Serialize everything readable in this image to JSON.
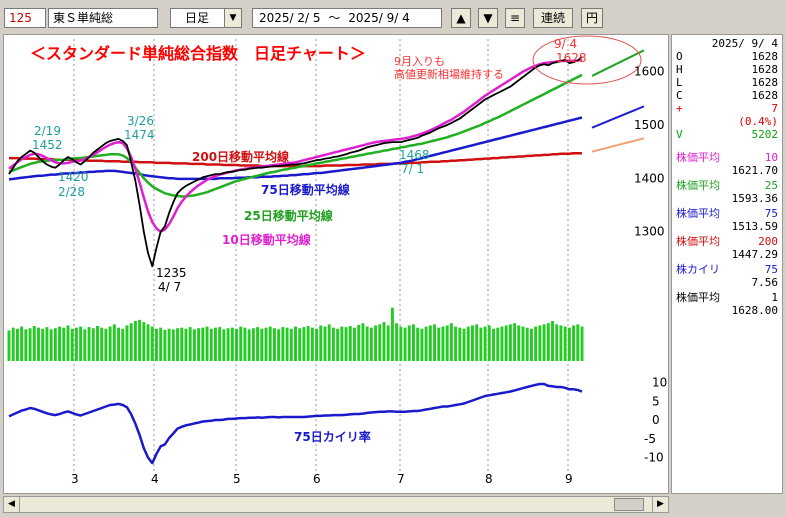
{
  "toolbar": {
    "code": "125",
    "name": "東Ｓ単純総",
    "period": "日足",
    "date_from": "2025/ 2/ 5",
    "tilde": "～",
    "date_to": "2025/ 9/ 4",
    "up_label": "▲",
    "down_label": "▼",
    "menu_label": "≡",
    "link_label": "連続",
    "yen_label": "円"
  },
  "chart": {
    "title": "＜スタンダード単純総合指数　日足チャート＞",
    "note_line1": "9月入りも",
    "note_line2": "高値更新相場維持する",
    "last_date": "9/ 4",
    "last_value": "1628",
    "ann_219_date": "2/19",
    "ann_219_value": "1452",
    "ann_326_date": "3/26",
    "ann_326_value": "1474",
    "ann_228_value": "1420",
    "ann_228_date": "2/28",
    "ann_low_value": "1235",
    "ann_low_date": "4/ 7",
    "ann_71_value": "1468",
    "ann_71_date": "7/ 1",
    "label_ma200": "200日移動平均線",
    "label_ma75": "75日移動平均線",
    "label_ma25": "25日移動平均線",
    "label_ma10": "10日移動平均線",
    "label_kairi": "75日カイリ率"
  },
  "colors": {
    "price": "#000000",
    "ma10": "#e020d0",
    "ma25": "#20b020",
    "ma75": "#1a1acc",
    "ma200": "#d01010",
    "volume": "#22cc22",
    "kairi": "#1a1acc",
    "title": "#ff0000",
    "cyan": "#20a0a0",
    "fc_green": "#20a020",
    "fc_blue": "#2020d0",
    "fc_orange": "#f0a070"
  },
  "side": {
    "date": "2025/ 9/ 4",
    "o_label": "O",
    "o_value": "1628",
    "h_label": "H",
    "h_value": "1628",
    "l_label": "L",
    "l_value": "1628",
    "c_label": "C",
    "c_value": "1628",
    "chg_label": "+",
    "chg_value": "7",
    "chg_pct": "(0.4%)",
    "v_label": "V",
    "v_value": "5202",
    "ma10_label": "株価平均",
    "ma10_period": "10",
    "ma10_value": "1621.70",
    "ma25_label": "株価平均",
    "ma25_period": "25",
    "ma25_value": "1593.36",
    "ma75_label": "株価平均",
    "ma75_period": "75",
    "ma75_value": "1513.59",
    "ma200_label": "株価平均",
    "ma200_period": "200",
    "ma200_value": "1447.29",
    "kairi_label": "株カイリ",
    "kairi_period": "75",
    "kairi_value": "7.56",
    "avg1_label": "株価平均",
    "avg1_period": "1",
    "avg1_value": "1628.00"
  },
  "chart_data": {
    "type": "line",
    "x_axis_months": [
      "3",
      "4",
      "5",
      "6",
      "7",
      "8",
      "9"
    ],
    "price_y_ticks": [
      1300,
      1400,
      1500,
      1600
    ],
    "price_ylim": [
      1200,
      1650
    ],
    "kairi_y_ticks": [
      10,
      5,
      0,
      -5,
      -10
    ],
    "kairi_ylim": [
      -12,
      12
    ],
    "price_close": [
      1408,
      1420,
      1432,
      1440,
      1446,
      1452,
      1448,
      1440,
      1432,
      1426,
      1422,
      1420,
      1426,
      1434,
      1440,
      1436,
      1430,
      1426,
      1432,
      1440,
      1448,
      1454,
      1460,
      1466,
      1470,
      1472,
      1474,
      1470,
      1462,
      1430,
      1395,
      1350,
      1300,
      1260,
      1235,
      1270,
      1300,
      1310,
      1335,
      1355,
      1372,
      1380,
      1386,
      1390,
      1394,
      1398,
      1402,
      1404,
      1406,
      1408,
      1408,
      1410,
      1412,
      1412,
      1414,
      1416,
      1416,
      1418,
      1419,
      1420,
      1420,
      1421,
      1422,
      1423,
      1423,
      1424,
      1425,
      1426,
      1426,
      1427,
      1428,
      1430,
      1432,
      1434,
      1435,
      1437,
      1438,
      1440,
      1441,
      1443,
      1445,
      1448,
      1450,
      1452,
      1455,
      1458,
      1460,
      1462,
      1464,
      1466,
      1467,
      1468,
      1468,
      1468,
      1470,
      1472,
      1474,
      1476,
      1480,
      1483,
      1486,
      1490,
      1494,
      1497,
      1500,
      1504,
      1508,
      1512,
      1518,
      1524,
      1530,
      1536,
      1542,
      1548,
      1552,
      1556,
      1560,
      1564,
      1568,
      1572,
      1578,
      1584,
      1590,
      1596,
      1602,
      1608,
      1612,
      1614,
      1612,
      1616,
      1618,
      1620,
      1622,
      1616,
      1618,
      1621,
      1628
    ],
    "ma10": [
      1418,
      1424,
      1430,
      1436,
      1440,
      1444,
      1446,
      1445,
      1442,
      1438,
      1434,
      1430,
      1428,
      1428,
      1429,
      1431,
      1432,
      1433,
      1436,
      1440,
      1444,
      1449,
      1454,
      1459,
      1463,
      1466,
      1468,
      1466,
      1456,
      1440,
      1418,
      1392,
      1364,
      1338,
      1318,
      1306,
      1300,
      1304,
      1314,
      1328,
      1344,
      1356,
      1366,
      1374,
      1381,
      1387,
      1392,
      1397,
      1401,
      1404,
      1407,
      1409,
      1411,
      1413,
      1415,
      1416,
      1418,
      1419,
      1420,
      1421,
      1422,
      1423,
      1424,
      1425,
      1426,
      1427,
      1428,
      1429,
      1430,
      1432,
      1434,
      1436,
      1438,
      1440,
      1442,
      1444,
      1446,
      1448,
      1450,
      1452,
      1454,
      1456,
      1458,
      1460,
      1462,
      1464,
      1466,
      1468,
      1469,
      1470,
      1471,
      1472,
      1473,
      1474,
      1475,
      1477,
      1479,
      1481,
      1484,
      1487,
      1490,
      1494,
      1498,
      1502,
      1506,
      1510,
      1515,
      1520,
      1525,
      1531,
      1537,
      1543,
      1549,
      1555,
      1560,
      1565,
      1570,
      1575,
      1580,
      1585,
      1590,
      1595,
      1600,
      1604,
      1608,
      1611,
      1614,
      1616,
      1617,
      1618,
      1619,
      1620,
      1620,
      1620,
      1620,
      1621,
      1622
    ],
    "ma25": [
      1412,
      1415,
      1418,
      1421,
      1424,
      1427,
      1429,
      1431,
      1432,
      1433,
      1434,
      1434,
      1435,
      1435,
      1436,
      1437,
      1438,
      1438,
      1439,
      1440,
      1441,
      1442,
      1443,
      1444,
      1445,
      1445,
      1445,
      1443,
      1438,
      1430,
      1420,
      1410,
      1400,
      1392,
      1385,
      1380,
      1376,
      1372,
      1370,
      1368,
      1367,
      1366,
      1366,
      1367,
      1368,
      1370,
      1372,
      1374,
      1377,
      1380,
      1383,
      1386,
      1389,
      1392,
      1395,
      1397,
      1399,
      1401,
      1403,
      1405,
      1407,
      1409,
      1411,
      1412,
      1414,
      1416,
      1417,
      1419,
      1420,
      1422,
      1423,
      1425,
      1426,
      1428,
      1429,
      1431,
      1432,
      1434,
      1435,
      1437,
      1438,
      1440,
      1441,
      1443,
      1444,
      1446,
      1447,
      1449,
      1450,
      1452,
      1453,
      1455,
      1456,
      1458,
      1459,
      1461,
      1462,
      1464,
      1465,
      1467,
      1469,
      1471,
      1473,
      1475,
      1477,
      1480,
      1482,
      1485,
      1488,
      1491,
      1494,
      1497,
      1500,
      1504,
      1507,
      1511,
      1514,
      1518,
      1522,
      1526,
      1530,
      1534,
      1538,
      1542,
      1546,
      1550,
      1554,
      1558,
      1562,
      1566,
      1570,
      1574,
      1578,
      1582,
      1586,
      1590,
      1594
    ],
    "ma75": [
      1398,
      1399,
      1400,
      1401,
      1402,
      1403,
      1404,
      1405,
      1405,
      1406,
      1407,
      1407,
      1408,
      1409,
      1409,
      1410,
      1410,
      1411,
      1411,
      1412,
      1412,
      1413,
      1413,
      1414,
      1414,
      1414,
      1413,
      1412,
      1411,
      1410,
      1409,
      1408,
      1406,
      1405,
      1404,
      1403,
      1402,
      1401,
      1400,
      1400,
      1399,
      1399,
      1399,
      1399,
      1399,
      1399,
      1399,
      1399,
      1399,
      1399,
      1400,
      1400,
      1400,
      1400,
      1401,
      1401,
      1401,
      1402,
      1402,
      1402,
      1403,
      1403,
      1403,
      1404,
      1404,
      1405,
      1405,
      1406,
      1406,
      1407,
      1408,
      1408,
      1409,
      1410,
      1410,
      1411,
      1412,
      1413,
      1414,
      1415,
      1416,
      1417,
      1418,
      1419,
      1420,
      1421,
      1422,
      1423,
      1424,
      1425,
      1426,
      1427,
      1428,
      1429,
      1431,
      1432,
      1434,
      1436,
      1438,
      1440,
      1442,
      1444,
      1446,
      1448,
      1450,
      1452,
      1454,
      1456,
      1458,
      1460,
      1462,
      1464,
      1466,
      1468,
      1470,
      1472,
      1474,
      1476,
      1478,
      1480,
      1482,
      1484,
      1486,
      1488,
      1490,
      1492,
      1494,
      1496,
      1498,
      1500,
      1502,
      1504,
      1506,
      1508,
      1510,
      1512,
      1514
    ],
    "ma200": [
      1438,
      1438,
      1438,
      1437,
      1437,
      1437,
      1437,
      1436,
      1436,
      1436,
      1436,
      1435,
      1435,
      1435,
      1435,
      1434,
      1434,
      1434,
      1434,
      1433,
      1433,
      1433,
      1433,
      1432,
      1432,
      1432,
      1432,
      1431,
      1431,
      1431,
      1431,
      1430,
      1430,
      1430,
      1430,
      1429,
      1429,
      1429,
      1429,
      1428,
      1428,
      1428,
      1428,
      1427,
      1427,
      1427,
      1427,
      1426,
      1426,
      1426,
      1426,
      1425,
      1425,
      1425,
      1425,
      1424,
      1424,
      1424,
      1424,
      1424,
      1423,
      1423,
      1423,
      1423,
      1423,
      1423,
      1423,
      1423,
      1423,
      1423,
      1423,
      1423,
      1423,
      1423,
      1423,
      1424,
      1424,
      1424,
      1424,
      1424,
      1425,
      1425,
      1425,
      1425,
      1426,
      1426,
      1426,
      1426,
      1427,
      1427,
      1427,
      1427,
      1428,
      1428,
      1428,
      1429,
      1429,
      1429,
      1430,
      1430,
      1431,
      1431,
      1431,
      1432,
      1432,
      1433,
      1433,
      1434,
      1434,
      1435,
      1435,
      1436,
      1436,
      1437,
      1437,
      1438,
      1438,
      1439,
      1439,
      1440,
      1440,
      1441,
      1441,
      1442,
      1442,
      1443,
      1443,
      1444,
      1444,
      1445,
      1445,
      1446,
      1446,
      1446,
      1447,
      1447,
      1447
    ],
    "volume": [
      55,
      60,
      58,
      62,
      57,
      59,
      63,
      60,
      58,
      61,
      57,
      59,
      62,
      60,
      64,
      58,
      60,
      62,
      57,
      61,
      59,
      63,
      60,
      58,
      62,
      66,
      60,
      58,
      64,
      68,
      72,
      74,
      70,
      66,
      62,
      58,
      60,
      56,
      58,
      57,
      59,
      60,
      58,
      61,
      57,
      59,
      60,
      62,
      58,
      60,
      61,
      57,
      59,
      60,
      58,
      62,
      60,
      57,
      59,
      61,
      58,
      60,
      62,
      59,
      57,
      61,
      60,
      58,
      62,
      59,
      61,
      63,
      60,
      58,
      64,
      62,
      66,
      60,
      58,
      62,
      61,
      63,
      60,
      65,
      68,
      62,
      60,
      64,
      66,
      70,
      64,
      96,
      68,
      62,
      60,
      64,
      66,
      60,
      58,
      62,
      64,
      66,
      60,
      62,
      64,
      68,
      62,
      60,
      58,
      62,
      64,
      66,
      60,
      62,
      64,
      58,
      60,
      62,
      64,
      66,
      68,
      64,
      62,
      60,
      58,
      62,
      64,
      66,
      68,
      72,
      66,
      64,
      62,
      60,
      64,
      66,
      62
    ],
    "kairi": [
      1,
      1.5,
      2,
      2.5,
      2.8,
      3.2,
      3,
      2.6,
      2.2,
      1.8,
      1.5,
      1.3,
      1.6,
      2,
      2.3,
      1.9,
      1.5,
      1.2,
      1.6,
      2,
      2.4,
      2.8,
      3.2,
      3.6,
      4,
      4.1,
      4.3,
      4,
      3.4,
      1.5,
      -1,
      -4,
      -7.5,
      -10,
      -11.5,
      -9,
      -7,
      -6.5,
      -4.8,
      -3.6,
      -2.3,
      -1.8,
      -1.4,
      -1.2,
      -0.9,
      -0.7,
      -0.4,
      -0.3,
      -0.2,
      0,
      0,
      0.1,
      0.3,
      0.3,
      0.4,
      0.5,
      0.5,
      0.6,
      0.6,
      0.7,
      0.6,
      0.7,
      0.8,
      0.8,
      0.7,
      0.8,
      0.8,
      0.8,
      0.8,
      0.8,
      0.8,
      0.9,
      1,
      1.1,
      1.1,
      1.2,
      1.2,
      1.3,
      1.3,
      1.3,
      1.4,
      1.5,
      1.6,
      1.6,
      1.7,
      1.9,
      2,
      2.1,
      2.2,
      2.2,
      2.3,
      2.3,
      2.2,
      2.2,
      2.2,
      2.3,
      2.4,
      2.4,
      2.6,
      2.8,
      3,
      3.2,
      3.4,
      3.6,
      3.6,
      3.8,
      4,
      4.2,
      4.4,
      4.8,
      5.2,
      5.6,
      6,
      6.4,
      6.6,
      6.8,
      7,
      7.2,
      7.4,
      7.6,
      7.9,
      8.2,
      8.5,
      8.8,
      9.1,
      9.4,
      9.6,
      9.6,
      9.1,
      9,
      8.8,
      8.8,
      8.6,
      8.2,
      8.2,
      8.0,
      7.56
    ],
    "forecast": [
      {
        "name": "ma25",
        "from": 1592,
        "to": 1640
      },
      {
        "name": "ma75",
        "from": 1495,
        "to": 1535
      },
      {
        "name": "ma200",
        "from": 1450,
        "to": 1475
      }
    ]
  }
}
